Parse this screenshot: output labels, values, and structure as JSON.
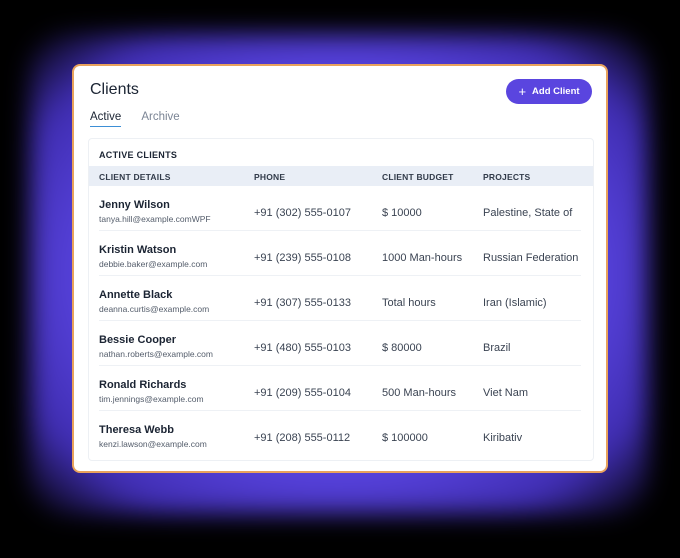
{
  "app": {
    "title": "Clients",
    "add_label": "Add Client",
    "accent": "#5a45df"
  },
  "tabs": [
    {
      "label": "Active",
      "selected": true
    },
    {
      "label": "Archive",
      "selected": false
    }
  ],
  "panel": {
    "title": "ACTIVE CLIENTS",
    "columns": [
      "CLIENT DETAILS",
      "PHONE",
      "CLIENT BUDGET",
      "PROJECTS"
    ]
  },
  "rows": [
    {
      "name": "Jenny Wilson",
      "email": "tanya.hill@example.comWPF",
      "phone": "+91 (302) 555-0107",
      "budget": "$ 10000",
      "project": "Palestine, State of"
    },
    {
      "name": "Kristin Watson",
      "email": "debbie.baker@example.com",
      "phone": "+91 (239) 555-0108",
      "budget": "1000 Man-hours",
      "project": "Russian Federation"
    },
    {
      "name": "Annette Black",
      "email": "deanna.curtis@example.com",
      "phone": "+91 (307) 555-0133",
      "budget": "Total hours",
      "project": "Iran (Islamic)"
    },
    {
      "name": "Bessie Cooper",
      "email": "nathan.roberts@example.com",
      "phone": "+91 (480) 555-0103",
      "budget": "$ 80000",
      "project": "Brazil"
    },
    {
      "name": "Ronald Richards",
      "email": "tim.jennings@example.com",
      "phone": "+91 (209) 555-0104",
      "budget": "500 Man-hours",
      "project": "Viet Nam"
    },
    {
      "name": "Theresa Webb",
      "email": "kenzi.lawson@example.com",
      "phone": "+91 (208) 555-0112",
      "budget": "$ 100000",
      "project": "Kiribativ"
    }
  ]
}
